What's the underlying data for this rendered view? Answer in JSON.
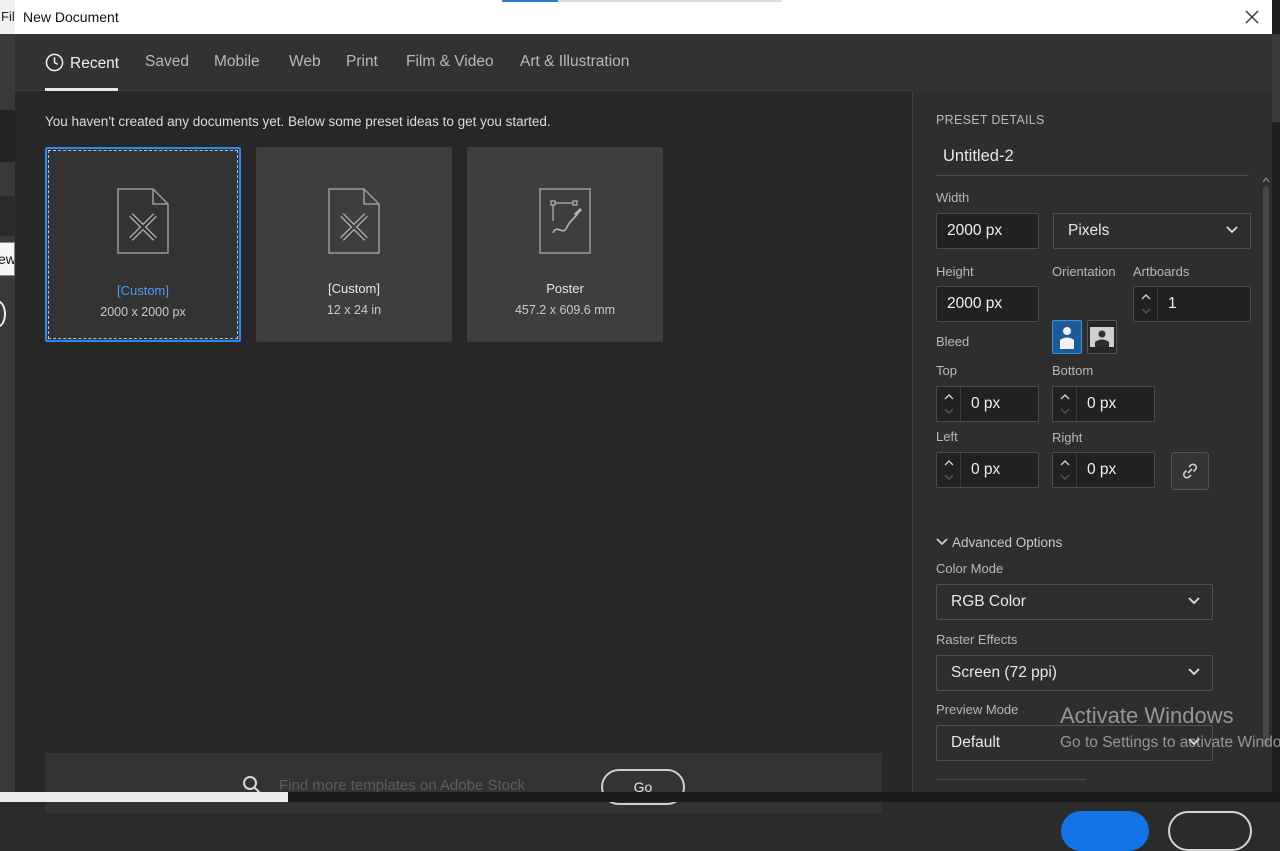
{
  "background_app": {
    "menu_fragment": "Fil",
    "tab_fragment": "ew"
  },
  "window": {
    "title": "New Document"
  },
  "tabs": [
    {
      "label": "Recent",
      "icon": "clock-icon"
    },
    {
      "label": "Saved"
    },
    {
      "label": "Mobile"
    },
    {
      "label": "Web"
    },
    {
      "label": "Print"
    },
    {
      "label": "Film & Video"
    },
    {
      "label": "Art & Illustration"
    }
  ],
  "recent": {
    "intro": "You haven't created any documents yet. Below some preset ideas to get you started.",
    "presets": [
      {
        "name": "[Custom]",
        "size": "2000 x 2000 px",
        "icon": "custom-document-icon",
        "selected": true
      },
      {
        "name": "[Custom]",
        "size": "12 x 24 in",
        "icon": "custom-document-icon",
        "selected": false
      },
      {
        "name": "Poster",
        "size": "457.2 x 609.6 mm",
        "icon": "poster-document-icon",
        "selected": false
      }
    ]
  },
  "stock_search": {
    "placeholder": "Find more templates on Adobe Stock",
    "go_label": "Go"
  },
  "preset_details": {
    "heading": "PRESET DETAILS",
    "document_name": "Untitled-2",
    "width_label": "Width",
    "width_value": "2000 px",
    "units_value": "Pixels",
    "height_label": "Height",
    "height_value": "2000 px",
    "orientation_label": "Orientation",
    "artboards_label": "Artboards",
    "artboards_value": "1",
    "bleed_label": "Bleed",
    "bleed_top_label": "Top",
    "bleed_top_value": "0 px",
    "bleed_bottom_label": "Bottom",
    "bleed_bottom_value": "0 px",
    "bleed_left_label": "Left",
    "bleed_left_value": "0 px",
    "bleed_right_label": "Right",
    "bleed_right_value": "0 px",
    "advanced_label": "Advanced Options",
    "color_mode_label": "Color Mode",
    "color_mode_value": "RGB Color",
    "raster_label": "Raster Effects",
    "raster_value": "Screen (72 ppi)",
    "preview_label": "Preview Mode",
    "preview_value": "Default"
  },
  "watermark": {
    "line1": "Activate Windows",
    "line2": "Go to Settings to activate Windows."
  },
  "colors": {
    "accent": "#2d8ceb",
    "create_button": "#1473e6",
    "panel_bg": "#2e2e2e",
    "main_bg": "#272727"
  }
}
